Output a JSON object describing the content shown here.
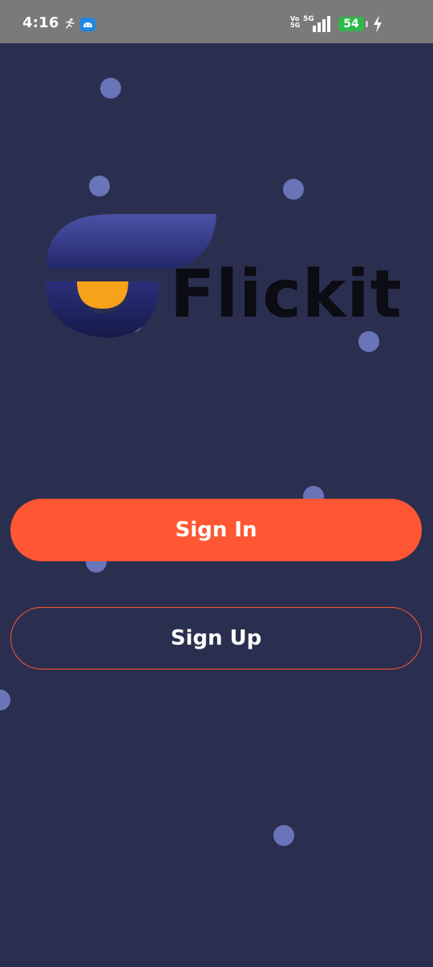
{
  "status_bar": {
    "time": "4:16",
    "volte": "Vo\n5G",
    "network": "5G",
    "battery": "54",
    "icons": [
      "activity-icon",
      "app-notification-icon",
      "volte-icon",
      "signal-icon",
      "battery-icon",
      "charging-bolt-icon"
    ]
  },
  "logo": {
    "text": "Flickit",
    "colors": {
      "mark_blue": "#3a3f8f",
      "mark_orange": "#f7a21b",
      "text": "#0c0c14"
    }
  },
  "buttons": {
    "sign_in": "Sign In",
    "sign_up": "Sign Up"
  },
  "colors": {
    "background": "#2b2f4f",
    "accent": "#ff5733",
    "dot": "#6a74b8",
    "status_bar": "#7a7a7a"
  }
}
